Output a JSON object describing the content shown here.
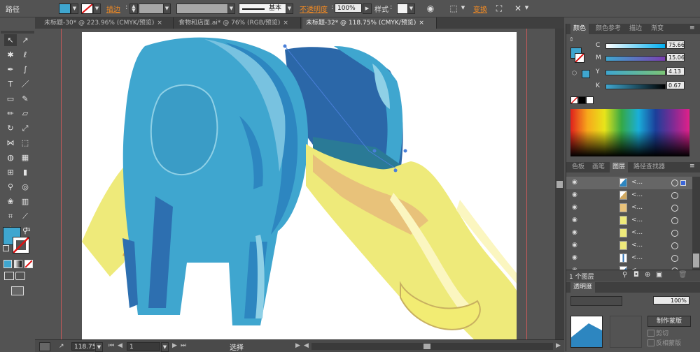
{
  "control_bar": {
    "selection_label": "路径",
    "fill_color": "#3fa6cf",
    "stroke_label": "描边",
    "stroke_style": "基本",
    "opacity_label": "不透明度",
    "opacity_value": "100%",
    "style_label": "样式",
    "transform_label": "变换"
  },
  "tabs": [
    {
      "label": "未标题-30* @ 223.96% (CMYK/预览)",
      "close": "×"
    },
    {
      "label": "食物和店面.ai* @ 76% (RGB/预览)",
      "close": "×"
    },
    {
      "label": "未标题-32* @ 118.75% (CMYK/预览)",
      "close": "×"
    }
  ],
  "tools": [
    {
      "icon": "selection-tool-icon",
      "glyph": "↖"
    },
    {
      "icon": "direct-selection-tool-icon",
      "glyph": "↗"
    },
    {
      "icon": "magic-wand-tool-icon",
      "glyph": "✱"
    },
    {
      "icon": "lasso-tool-icon",
      "glyph": "ℓ"
    },
    {
      "icon": "pen-tool-icon",
      "glyph": "✒"
    },
    {
      "icon": "curvature-tool-icon",
      "glyph": "∫"
    },
    {
      "icon": "type-tool-icon",
      "glyph": "T"
    },
    {
      "icon": "line-tool-icon",
      "glyph": "／"
    },
    {
      "icon": "rectangle-tool-icon",
      "glyph": "▭"
    },
    {
      "icon": "paintbrush-tool-icon",
      "glyph": "✎"
    },
    {
      "icon": "pencil-tool-icon",
      "glyph": "✏"
    },
    {
      "icon": "eraser-tool-icon",
      "glyph": "▱"
    },
    {
      "icon": "rotate-tool-icon",
      "glyph": "↻"
    },
    {
      "icon": "scale-tool-icon",
      "glyph": "⤢"
    },
    {
      "icon": "width-tool-icon",
      "glyph": "⋈"
    },
    {
      "icon": "free-transform-tool-icon",
      "glyph": "⬚"
    },
    {
      "icon": "shape-builder-tool-icon",
      "glyph": "◍"
    },
    {
      "icon": "perspective-grid-tool-icon",
      "glyph": "▦"
    },
    {
      "icon": "mesh-tool-icon",
      "glyph": "⊞"
    },
    {
      "icon": "gradient-tool-icon",
      "glyph": "▮"
    },
    {
      "icon": "eyedropper-tool-icon",
      "glyph": "⚲"
    },
    {
      "icon": "blend-tool-icon",
      "glyph": "◎"
    },
    {
      "icon": "symbol-sprayer-tool-icon",
      "glyph": "❀"
    },
    {
      "icon": "column-graph-tool-icon",
      "glyph": "▥"
    },
    {
      "icon": "artboard-tool-icon",
      "glyph": "⌗"
    },
    {
      "icon": "slice-tool-icon",
      "glyph": "⟋"
    },
    {
      "icon": "hand-tool-icon",
      "glyph": "✋"
    },
    {
      "icon": "zoom-tool-icon",
      "glyph": "⚲"
    }
  ],
  "status_bar": {
    "zoom": "118.75",
    "artboard": "1",
    "tool_name": "选择"
  },
  "color_panel": {
    "tabs": [
      "颜色",
      "颜色参考",
      "描边",
      "渐变"
    ],
    "channels": [
      {
        "label": "C",
        "value": "75.66"
      },
      {
        "label": "M",
        "value": "15.06"
      },
      {
        "label": "Y",
        "value": "4.13"
      },
      {
        "label": "K",
        "value": "0.67"
      }
    ],
    "current_color": "#3fa6cf"
  },
  "layers_panel": {
    "tabs": [
      "色板",
      "画笔",
      "图层",
      "路径查找器"
    ],
    "rows": [
      {
        "name": "<...",
        "thumb": "#2d86c0"
      },
      {
        "name": "<...",
        "thumb": "#d0a860"
      },
      {
        "name": "<...",
        "thumb": "#e8c27a"
      },
      {
        "name": "<...",
        "thumb": "#eeea7a"
      },
      {
        "name": "<...",
        "thumb": "#eeea7a"
      },
      {
        "name": "<...",
        "thumb": "#eeea7a"
      },
      {
        "name": "<...",
        "thumb": "#ffffff"
      },
      {
        "name": "<...",
        "thumb": "#2d6fb0"
      }
    ],
    "layer_count": "1 个图层",
    "footer_buttons": [
      "locate-object-icon",
      "make-clipping-mask-icon",
      "new-sublayer-icon",
      "new-layer-icon",
      "delete-layer-icon"
    ]
  },
  "transparency_panel": {
    "tab": "透明度",
    "opacity_value": "100%",
    "make_mask_label": "制作蒙版",
    "clip_label": "剪切",
    "invert_label": "反相蒙版"
  }
}
